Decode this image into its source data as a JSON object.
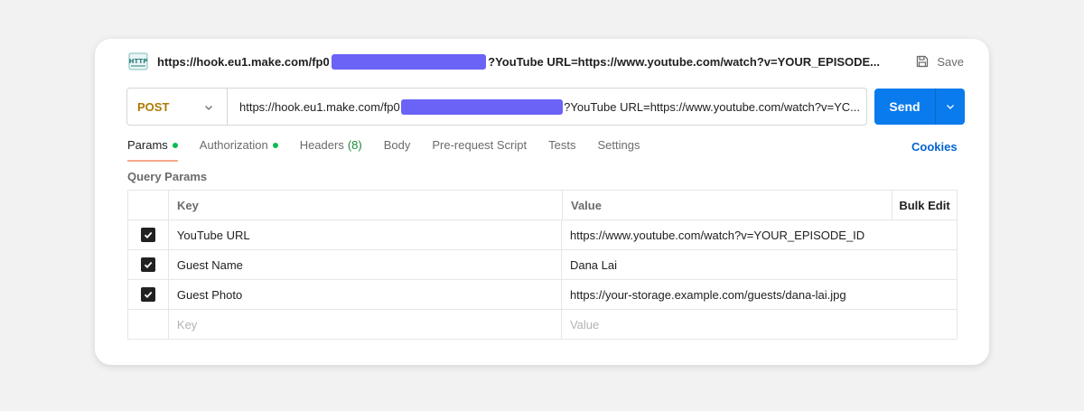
{
  "header": {
    "icon": "http-icon",
    "url_prefix": "https://hook.eu1.make.com/fp0",
    "url_suffix": "?YouTube URL=https://www.youtube.com/watch?v=YOUR_EPISODE...",
    "save_label": "Save"
  },
  "request": {
    "method": "POST",
    "url_prefix": "https://hook.eu1.make.com/fp0",
    "url_suffix": "?YouTube URL=https://www.youtube.com/watch?v=YC...",
    "send_label": "Send"
  },
  "tabs": {
    "params": "Params",
    "authorization": "Authorization",
    "headers": "Headers",
    "headers_count": "(8)",
    "body": "Body",
    "prerequest": "Pre-request Script",
    "tests": "Tests",
    "settings": "Settings",
    "cookies": "Cookies"
  },
  "query_params": {
    "label": "Query Params",
    "columns": {
      "key": "Key",
      "value": "Value",
      "bulk_edit": "Bulk Edit"
    },
    "rows": [
      {
        "checked": true,
        "key": "YouTube URL",
        "value": "https://www.youtube.com/watch?v=YOUR_EPISODE_ID"
      },
      {
        "checked": true,
        "key": "Guest Name",
        "value": "Dana Lai"
      },
      {
        "checked": true,
        "key": "Guest Photo",
        "value": "https://your-storage.example.com/guests/dana-lai.jpg"
      }
    ],
    "placeholder": {
      "key": "Key",
      "value": "Value"
    }
  },
  "colors": {
    "method": "#ad7a03",
    "send": "#097bed",
    "redaction": "#6b63f6",
    "status_dot": "#0cbb52",
    "cookies_link": "#0265d2"
  }
}
